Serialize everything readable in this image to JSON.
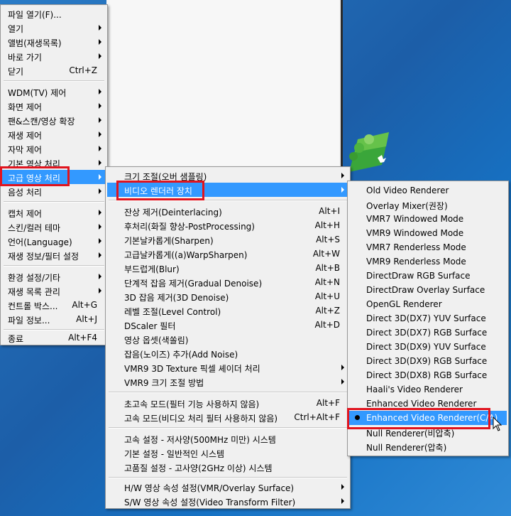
{
  "main_menu": {
    "items": [
      {
        "label": "파일 열기(F)...",
        "shortcut": "",
        "submenu": false
      },
      {
        "label": "열기",
        "shortcut": "",
        "submenu": true
      },
      {
        "label": "앨범(재생목록)",
        "shortcut": "",
        "submenu": true
      },
      {
        "label": "바로 가기",
        "shortcut": "",
        "submenu": true
      },
      {
        "label": "닫기",
        "shortcut": "Ctrl+Z",
        "submenu": false
      },
      {
        "label": "WDM(TV) 제어",
        "shortcut": "",
        "submenu": true
      },
      {
        "label": "화면 제어",
        "shortcut": "",
        "submenu": true
      },
      {
        "label": "팬&스캔/영상 확장",
        "shortcut": "",
        "submenu": true
      },
      {
        "label": "재생 제어",
        "shortcut": "",
        "submenu": true
      },
      {
        "label": "자막 제어",
        "shortcut": "",
        "submenu": true
      },
      {
        "label": "기본 영상 처리",
        "shortcut": "",
        "submenu": true
      },
      {
        "label": "고급 영상 처리",
        "shortcut": "",
        "submenu": true
      },
      {
        "label": "음성 처리",
        "shortcut": "",
        "submenu": true
      },
      {
        "label": "캡처 제어",
        "shortcut": "",
        "submenu": true
      },
      {
        "label": "스킨/컬러 테마",
        "shortcut": "",
        "submenu": true
      },
      {
        "label": "언어(Language)",
        "shortcut": "",
        "submenu": true
      },
      {
        "label": "재생 정보/필터 설정",
        "shortcut": "",
        "submenu": true
      },
      {
        "label": "환경 설정/기타",
        "shortcut": "",
        "submenu": true
      },
      {
        "label": "재생 목록 관리",
        "shortcut": "",
        "submenu": true
      },
      {
        "label": "컨트롤 박스...",
        "shortcut": "Alt+G",
        "submenu": false
      },
      {
        "label": "파일 정보...",
        "shortcut": "Alt+J",
        "submenu": false
      },
      {
        "label": "종료",
        "shortcut": "Alt+F4",
        "submenu": false
      }
    ]
  },
  "advanced_menu": {
    "items": [
      {
        "label": "크기 조절(오버 샘플링)",
        "shortcut": "",
        "submenu": true
      },
      {
        "label": "비디오 렌더러 장치",
        "shortcut": "",
        "submenu": true
      },
      {
        "label": "잔상 제거(Deinterlacing)",
        "shortcut": "Alt+I",
        "submenu": false
      },
      {
        "label": "후처리(화질 향상-PostProcessing)",
        "shortcut": "Alt+H",
        "submenu": false
      },
      {
        "label": "기본날카롭게(Sharpen)",
        "shortcut": "Alt+S",
        "submenu": false
      },
      {
        "label": "고급날카롭게((a)WarpSharpen)",
        "shortcut": "Alt+W",
        "submenu": false
      },
      {
        "label": "부드럽게(Blur)",
        "shortcut": "Alt+B",
        "submenu": false
      },
      {
        "label": "단계적 잡음 제거(Gradual Denoise)",
        "shortcut": "Alt+N",
        "submenu": false
      },
      {
        "label": "3D 잡음 제거(3D Denoise)",
        "shortcut": "Alt+U",
        "submenu": false
      },
      {
        "label": "레벨 조절(Level Control)",
        "shortcut": "Alt+Z",
        "submenu": false
      },
      {
        "label": "DScaler 필터",
        "shortcut": "Alt+D",
        "submenu": false
      },
      {
        "label": "영상 옵셋(색쏠림)",
        "shortcut": "",
        "submenu": false
      },
      {
        "label": "잡음(노이즈) 추가(Add Noise)",
        "shortcut": "",
        "submenu": false
      },
      {
        "label": "VMR9 3D Texture 픽셀 셰이더 처리",
        "shortcut": "",
        "submenu": true
      },
      {
        "label": "VMR9 크기 조절 방법",
        "shortcut": "",
        "submenu": true
      },
      {
        "label": "초고속 모드(필터 기능 사용하지 않음)",
        "shortcut": "Alt+F",
        "submenu": false
      },
      {
        "label": "고속 모드(비디오 처리 필터 사용하지 않음)",
        "shortcut": "Ctrl+Alt+F",
        "submenu": false
      },
      {
        "label": "고속 설정 - 저사양(500MHz 미만) 시스템",
        "shortcut": "",
        "submenu": false
      },
      {
        "label": "기본 설정 - 일반적인 시스템",
        "shortcut": "",
        "submenu": false
      },
      {
        "label": "고품질 설정 - 고사양(2GHz 이상) 시스템",
        "shortcut": "",
        "submenu": false
      },
      {
        "label": "H/W 영상 속성 설정(VMR/Overlay Surface)",
        "shortcut": "",
        "submenu": true
      },
      {
        "label": "S/W 영상 속성 설정(Video Transform Filter)",
        "shortcut": "",
        "submenu": true
      }
    ]
  },
  "renderer_menu": {
    "items": [
      {
        "label": "Old Video Renderer",
        "selected": false
      },
      {
        "label": "Overlay Mixer(권장)",
        "selected": false
      },
      {
        "label": "VMR7 Windowed Mode",
        "selected": false
      },
      {
        "label": "VMR9 Windowed Mode",
        "selected": false
      },
      {
        "label": "VMR7 Renderless Mode",
        "selected": false
      },
      {
        "label": "VMR9 Renderless Mode",
        "selected": false
      },
      {
        "label": "DirectDraw RGB Surface",
        "selected": false
      },
      {
        "label": "DirectDraw Overlay Surface",
        "selected": false
      },
      {
        "label": "OpenGL Renderer",
        "selected": false
      },
      {
        "label": "Direct 3D(DX7) YUV Surface",
        "selected": false
      },
      {
        "label": "Direct 3D(DX7) RGB Surface",
        "selected": false
      },
      {
        "label": "Direct 3D(DX9) YUV Surface",
        "selected": false
      },
      {
        "label": "Direct 3D(DX9) RGB Surface",
        "selected": false
      },
      {
        "label": "Direct 3D(DX8) RGB Surface",
        "selected": false
      },
      {
        "label": "Haali's Video Renderer",
        "selected": false
      },
      {
        "label": "Enhanced Video Renderer",
        "selected": false
      },
      {
        "label": "Enhanced Video Renderer(C/A)",
        "selected": true
      },
      {
        "label": "Null Renderer(비압축)",
        "selected": false
      },
      {
        "label": "Null Renderer(압축)",
        "selected": false
      }
    ]
  },
  "colors": {
    "highlight": "#3399ff",
    "annotation_red": "#e0141e",
    "menu_bg": "#f0f0f0"
  }
}
